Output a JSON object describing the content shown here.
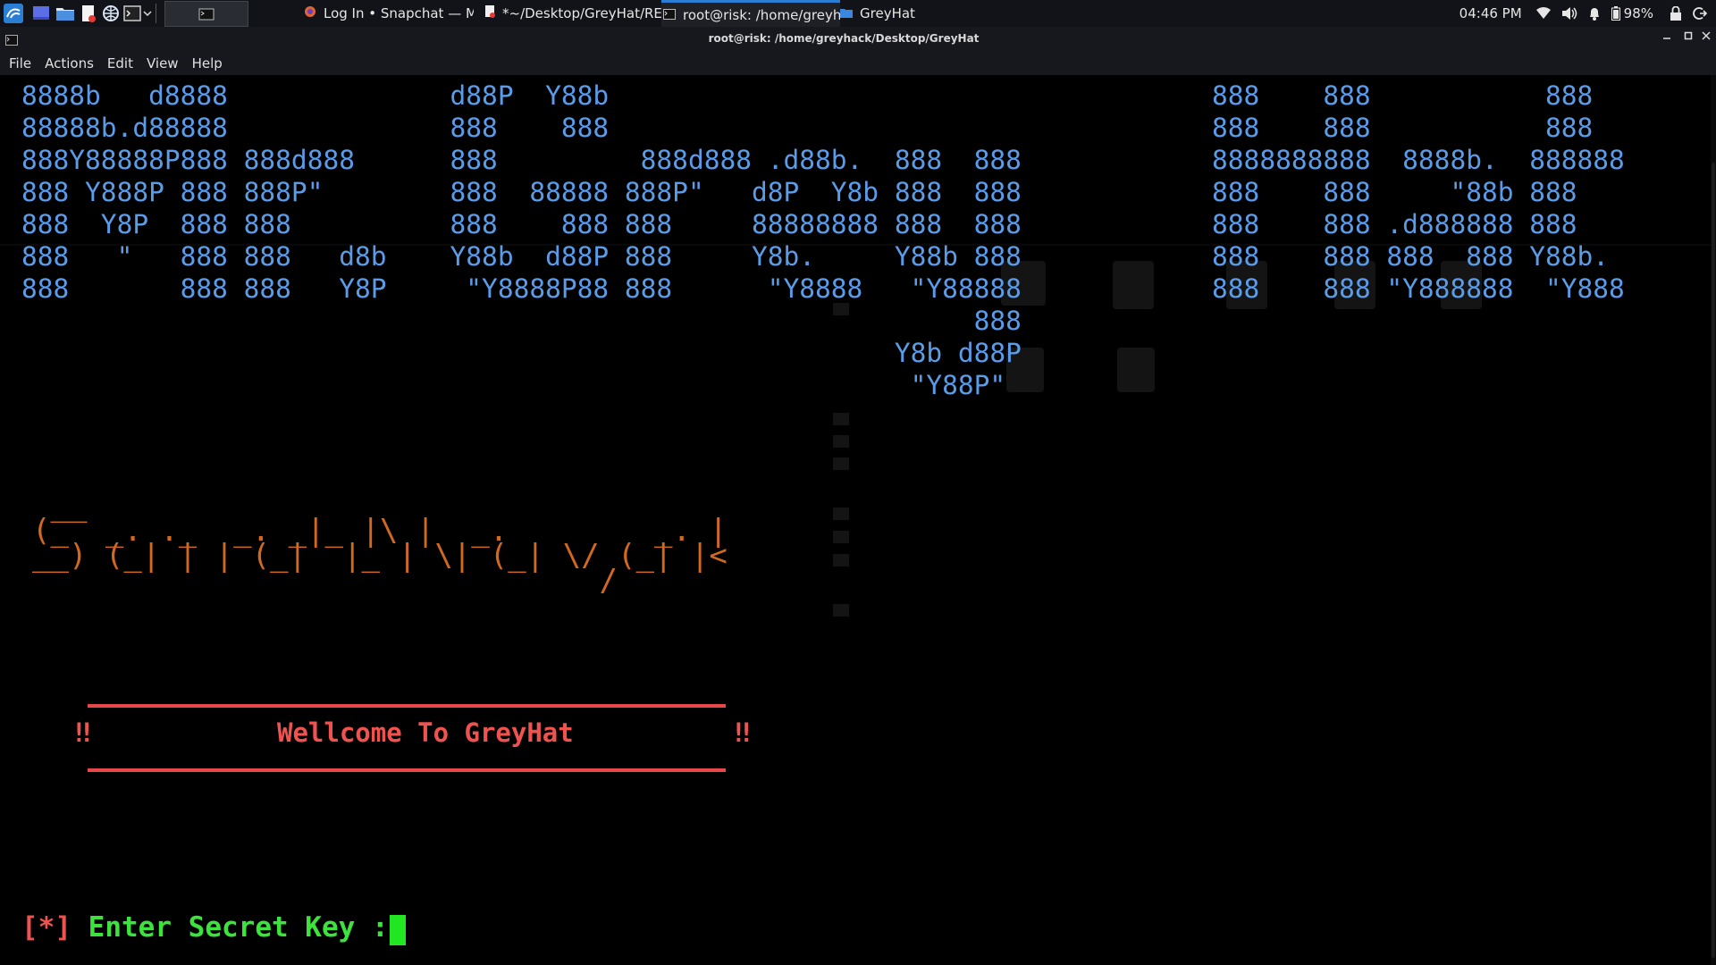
{
  "panel": {
    "tasks": [
      {
        "label": "Log In • Snapchat — Mo...",
        "icon": "firefox-icon"
      },
      {
        "label": "*~/Desktop/GreyHat/RE...",
        "icon": "text-editor-icon"
      },
      {
        "label": "root@risk: /home/greyh...",
        "icon": "terminal-icon"
      },
      {
        "label": "GreyHat",
        "icon": "folder-icon"
      }
    ],
    "clock": "04:46 PM",
    "battery": "98%"
  },
  "window": {
    "title": "root@risk: /home/greyhack/Desktop/GreyHat"
  },
  "menu": {
    "file": "File",
    "actions": "Actions",
    "edit": "Edit",
    "view": "View",
    "help": "Help"
  },
  "terminal": {
    "banner": "8888b   d8888              d88P  Y88b                                      888    888           888\n88888b.d88888              888    888                                      888    888           888\n888Y88888P888 888d888      888         888d888 .d88b.  888  888            8888888888  8888b.  888888\n888 Y888P 888 888P\"        888  88888 888P\"   d8P  Y8b 888  888            888    888     \"88b 888\n888  Y8P  888 888          888    888 888     88888888 888  888            888    888 .d888888 888\n888   \"   888 888   d8b    Y88b  d88P 888     Y8b.     Y88b 888            888    888 888  888 Y88b.\n888       888 888   Y8P     \"Y8888P88 888      \"Y8888   \"Y88888            888    888 \"Y888888  \"Y888\n                                                            888\n                                                       Y8b d88P\n                                                        \"Y88P\"",
    "ascii_lines": [
      " __",
      "(_  _. ._  _. _|_ |\\ |  _.        _. |",
      "__) (_| | | (_|  |_ | \\| (_| \\/ (_| |<",
      "                               /"
    ],
    "welcome_bang": "‼",
    "welcome": "Wellcome To GreyHat",
    "prompt_open": "[",
    "prompt_star": "*",
    "prompt_close": "]",
    "prompt_label": " Enter Secret Key : "
  },
  "colors": {
    "banner": "#5b9ce8",
    "ascii": "#d2691e",
    "welcome": "#ef5350",
    "prompt": "#3ce33c",
    "cursor": "#22e622"
  }
}
